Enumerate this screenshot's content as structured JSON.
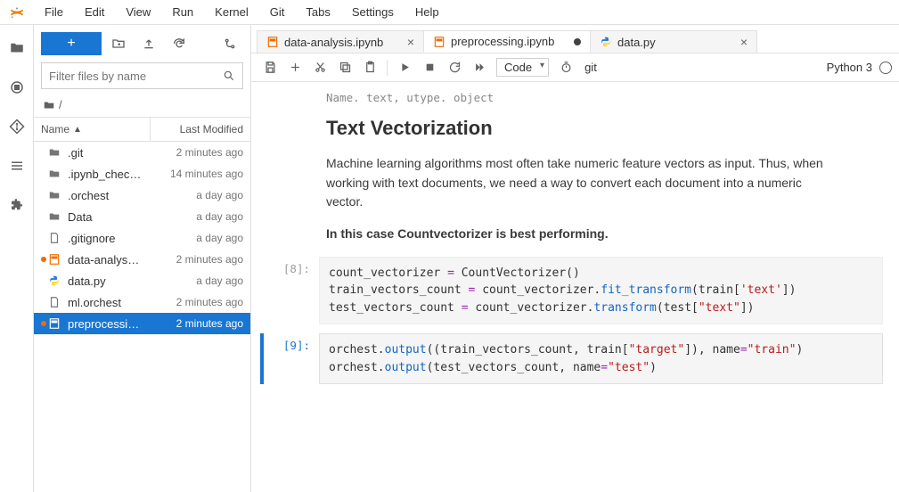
{
  "menubar": [
    "File",
    "Edit",
    "View",
    "Run",
    "Kernel",
    "Git",
    "Tabs",
    "Settings",
    "Help"
  ],
  "activity_icons": [
    "folder-icon",
    "circle-stop-icon",
    "git-diff-icon",
    "list-icon",
    "extension-icon"
  ],
  "file_toolbar": {
    "filter_placeholder": "Filter files by name"
  },
  "breadcrumb": "/",
  "file_header": {
    "name": "Name",
    "modified": "Last Modified"
  },
  "files": [
    {
      "icon": "folder",
      "name": ".git",
      "modified": "2 minutes ago",
      "running": false
    },
    {
      "icon": "folder",
      "name": ".ipynb_chec…",
      "modified": "14 minutes ago",
      "running": false
    },
    {
      "icon": "folder",
      "name": ".orchest",
      "modified": "a day ago",
      "running": false
    },
    {
      "icon": "folder",
      "name": "Data",
      "modified": "a day ago",
      "running": false
    },
    {
      "icon": "file",
      "name": ".gitignore",
      "modified": "a day ago",
      "running": false
    },
    {
      "icon": "notebook",
      "name": "data-analys…",
      "modified": "2 minutes ago",
      "running": true
    },
    {
      "icon": "python",
      "name": "data.py",
      "modified": "a day ago",
      "running": false
    },
    {
      "icon": "file",
      "name": "ml.orchest",
      "modified": "2 minutes ago",
      "running": false
    },
    {
      "icon": "notebook",
      "name": "preprocessi…",
      "modified": "2 minutes ago",
      "running": true,
      "selected": true
    }
  ],
  "tabs": [
    {
      "icon": "notebook",
      "label": "data-analysis.ipynb",
      "dirty": false,
      "active": false
    },
    {
      "icon": "notebook",
      "label": "preprocessing.ipynb",
      "dirty": true,
      "active": true
    },
    {
      "icon": "python",
      "label": "data.py",
      "dirty": false,
      "active": false
    }
  ],
  "nb_toolbar": {
    "celltype": "Code",
    "git_label": "git",
    "kernel": "Python 3"
  },
  "notebook": {
    "truncated": "Name. text, utype. object",
    "md": {
      "heading": "Text Vectorization",
      "para": "Machine learning algorithms most often take numeric feature vectors as input. Thus, when working with text documents, we need a way to convert each document into a numeric vector.",
      "bold": "In this case Countvectorizer is best performing."
    },
    "cells": [
      {
        "prompt": "[8]:",
        "lines": [
          [
            {
              "t": "count_vectorizer "
            },
            {
              "t": "=",
              "c": "op"
            },
            {
              "t": " CountVectorizer()"
            }
          ],
          [
            {
              "t": "train_vectors_count "
            },
            {
              "t": "=",
              "c": "op"
            },
            {
              "t": " count_vectorizer."
            },
            {
              "t": "fit_transform",
              "c": "fn"
            },
            {
              "t": "(train["
            },
            {
              "t": "'text'",
              "c": "str"
            },
            {
              "t": "])"
            }
          ],
          [
            {
              "t": "test_vectors_count "
            },
            {
              "t": "=",
              "c": "op"
            },
            {
              "t": " count_vectorizer."
            },
            {
              "t": "transform",
              "c": "fn"
            },
            {
              "t": "(test["
            },
            {
              "t": "\"text\"",
              "c": "str"
            },
            {
              "t": "])"
            }
          ]
        ],
        "active": false
      },
      {
        "prompt": "[9]:",
        "lines": [
          [
            {
              "t": "orchest."
            },
            {
              "t": "output",
              "c": "fn"
            },
            {
              "t": "((train_vectors_count, train["
            },
            {
              "t": "\"target\"",
              "c": "str"
            },
            {
              "t": "]), name"
            },
            {
              "t": "=",
              "c": "op"
            },
            {
              "t": "\"train\"",
              "c": "str"
            },
            {
              "t": ")"
            }
          ],
          [
            {
              "t": "orchest."
            },
            {
              "t": "output",
              "c": "fn"
            },
            {
              "t": "(test_vectors_count, name"
            },
            {
              "t": "=",
              "c": "op"
            },
            {
              "t": "\"test\"",
              "c": "str"
            },
            {
              "t": ")"
            }
          ]
        ],
        "active": true
      }
    ]
  }
}
